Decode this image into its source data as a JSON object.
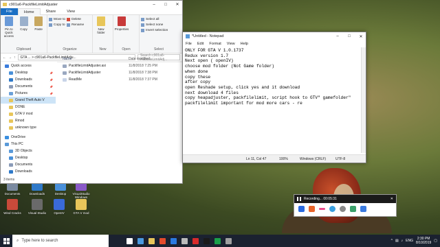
{
  "explorer": {
    "title": "c901a6-PackfileLimitAdjuster",
    "tabs": [
      "File",
      "Home",
      "Share",
      "View"
    ],
    "ribbon": {
      "pin_label": "Pin to Quick access",
      "copy_label": "Copy",
      "paste_label": "Paste",
      "cut_label": "Cut",
      "copy_path_label": "Copy path",
      "paste_shortcut_label": "Paste shortcut",
      "move_to_label": "Move to",
      "copy_to_label": "Copy to",
      "delete_label": "Delete",
      "rename_label": "Rename",
      "new_folder_label": "New folder",
      "new_item_label": "New item",
      "easy_access_label": "Easy access",
      "properties_label": "Properties",
      "open_label": "Open",
      "edit_label": "Edit",
      "history_label": "History",
      "select_all_label": "Select all",
      "select_none_label": "Select none",
      "invert_label": "Invert selection",
      "groups": [
        "Clipboard",
        "Organize",
        "New",
        "Open",
        "Select"
      ]
    },
    "address_path": "GTA ...  >  c901a6-PackfileLimitAdju...",
    "search_placeholder": "Search c901a6-PackfileLimitAdj...",
    "nav_items": [
      {
        "label": "Quick access",
        "color": "#3b7ddd"
      },
      {
        "label": "Desktop",
        "color": "#4a90d9"
      },
      {
        "label": "Downloads",
        "color": "#2f79c8"
      },
      {
        "label": "Documents",
        "color": "#8a9bb8"
      },
      {
        "label": "Pictures",
        "color": "#6aa0d8"
      },
      {
        "label": "Grand Theft Auto V",
        "color": "#e8c65a"
      },
      {
        "label": "DONE",
        "color": "#e8c65a"
      },
      {
        "label": "GTA V mod",
        "color": "#e8c65a"
      },
      {
        "label": "Rmod",
        "color": "#e8c65a"
      },
      {
        "label": "unknown type",
        "color": "#e8c65a"
      },
      {
        "label": "OneDrive",
        "color": "#3a8fe0"
      },
      {
        "label": "This PC",
        "color": "#5a9ad8"
      },
      {
        "label": "3D Objects",
        "color": "#5a9ad8"
      },
      {
        "label": "Desktop",
        "color": "#4a90d9"
      },
      {
        "label": "Documents",
        "color": "#8a9bb8"
      },
      {
        "label": "Downloads",
        "color": "#2f79c8"
      }
    ],
    "columns": [
      "Name",
      "Date modified"
    ],
    "files": [
      {
        "name": "PackfileLimitAdjuster.asi",
        "date": "11/8/2018 7:25 PM"
      },
      {
        "name": "PackfileLimitAdjuster",
        "date": "11/8/2018 7:38 PM"
      },
      {
        "name": "ReadMe",
        "date": "11/8/2018 7:37 PM"
      }
    ],
    "status": "3 items"
  },
  "notepad": {
    "title": "*Untitled - Notepad",
    "menu": [
      "File",
      "Edit",
      "Format",
      "View",
      "Help"
    ],
    "text": "ONLY FOR GTA V 1.0.1737\nRedux version 1.7\nNext open ( openIV)\nchoose mod folder (Not Game folder)\nwhen done\ncopy these\nafter copy\nopen Reshade setup, click yes and it download\nnext download 4 files\ncopy heapadjuster, packfilelimit, script hook to GTV\" gamefolder\"\npackfilelimit important for mod more cars - re",
    "status_pos": "Ln 11, Col 47",
    "status_zoom": "100%",
    "status_eol": "Windows (CRLF)",
    "status_enc": "UTF-8"
  },
  "desktop_icons": [
    {
      "label": "Documents",
      "color": "#7a8aa0"
    },
    {
      "label": "Downloads",
      "color": "#2f79c8"
    },
    {
      "label": "Desktop",
      "color": "#4a90d9"
    },
    {
      "label": "VisualStudio Windows",
      "color": "#8a5ac8"
    },
    {
      "label": "Wind Cracks",
      "color": "#c84a3a"
    },
    {
      "label": "Visual Studio",
      "color": "#6a6a6a"
    },
    {
      "label": "OpenIV",
      "color": "#3a6ad8"
    },
    {
      "label": "GTA V mod",
      "color": "#e8c65a"
    }
  ],
  "recorder": {
    "title": "Recording... 00:05:31"
  },
  "taskbar": {
    "search_placeholder": "Type here to search",
    "apps": [
      "#ffffff",
      "#4a9ae0",
      "#e8c65a",
      "#e44a2a",
      "#2a7ae0",
      "#bbbbbb",
      "#d82a2a",
      "#1a1a1a",
      "#1aa04a",
      "#a0a0a0"
    ],
    "lang": "ENG",
    "time": "2:30 PM",
    "date": "8/10/2019"
  }
}
